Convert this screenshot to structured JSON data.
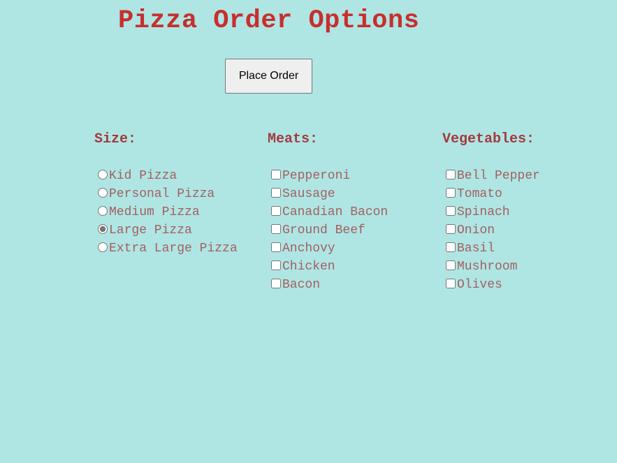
{
  "page": {
    "title": "Pizza Order Options",
    "background": "#afe6e4",
    "accent": "#c72f2d"
  },
  "actions": {
    "place_order_label": "Place Order"
  },
  "size": {
    "heading": "Size:",
    "options": [
      "Kid Pizza",
      "Personal Pizza",
      "Medium Pizza",
      "Large Pizza",
      "Extra Large Pizza"
    ],
    "selected": "Large Pizza"
  },
  "meats": {
    "heading": "Meats:",
    "options": [
      "Pepperoni",
      "Sausage",
      "Canadian Bacon",
      "Ground Beef",
      "Anchovy",
      "Chicken",
      "Bacon"
    ],
    "checked": []
  },
  "vegetables": {
    "heading": "Vegetables:",
    "options": [
      "Bell Pepper",
      "Tomato",
      "Spinach",
      "Onion",
      "Basil",
      "Mushroom",
      "Olives"
    ],
    "checked": []
  }
}
